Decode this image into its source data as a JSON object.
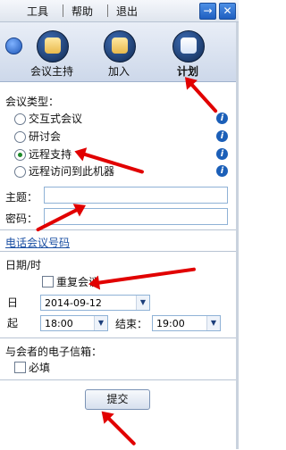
{
  "menu": {
    "tools": "工具",
    "help": "帮助",
    "exit": "退出"
  },
  "window_buttons": {
    "arrow": "→",
    "close": "✕"
  },
  "tabs": [
    {
      "label": "会议主持"
    },
    {
      "label": "加入"
    },
    {
      "label": "计划"
    }
  ],
  "form": {
    "meeting_type_label": "会议类型：",
    "types": [
      {
        "label": "交互式会议",
        "selected": false
      },
      {
        "label": "研讨会",
        "selected": false
      },
      {
        "label": "远程支持",
        "selected": true
      },
      {
        "label": "远程访问到此机器",
        "selected": false
      }
    ],
    "topic_label": "主题：",
    "topic_value": "",
    "password_label": "密码：",
    "password_value": "",
    "phone_link": "电话会议号码",
    "datetime_label": "日期/时",
    "repeat_label": "重复会议",
    "date_label": "日",
    "date_value": "2014-09-12",
    "start_label": "起",
    "start_time": "18:00",
    "end_label": "结束：",
    "end_time": "19:00",
    "email_label": "与会者的电子信箱：",
    "required_label": "必填",
    "submit_label": "提交"
  },
  "icons": {
    "info": "i",
    "dropdown": "▼"
  }
}
